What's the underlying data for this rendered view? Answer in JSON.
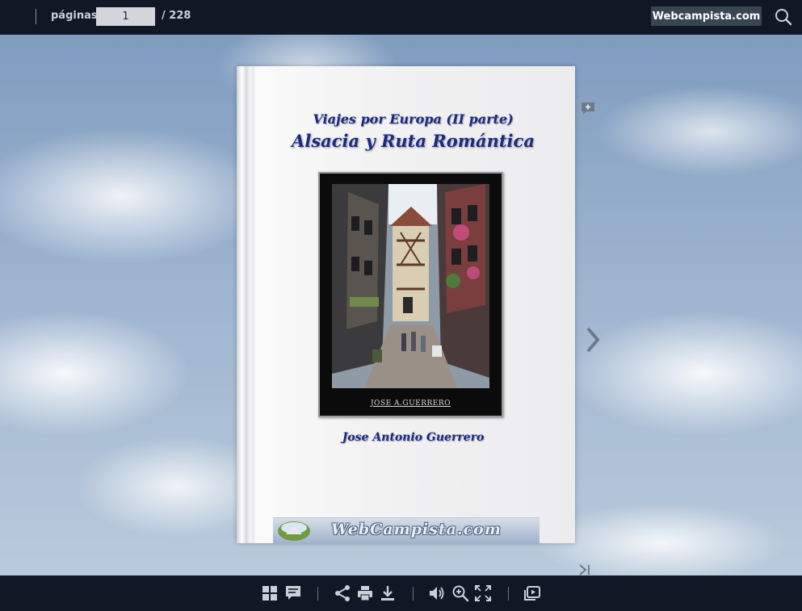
{
  "topbar": {
    "pages_label": "páginas:",
    "current_page": "1",
    "total_pages": "/ 228",
    "site_button_label": "Webcampista.com"
  },
  "book": {
    "kicker": "Viajes por Europa (II parte)",
    "title": "Alsacia y Ruta Romántica",
    "photo_caption": "JOSE A.GUERRERO",
    "author": "Jose Antonio Guerrero",
    "banner_text": "WebCampista.com"
  },
  "colors": {
    "bar_bg": "#0f1824",
    "title_blue": "#1a2a86",
    "site_button_bg": "#3a4552"
  },
  "icons": {
    "topbar": [
      "search-icon"
    ],
    "side": [
      "add-note-icon",
      "chevron-right-icon",
      "last-page-icon"
    ],
    "bottombar": [
      "thumbnails-icon",
      "notes-icon",
      "share-icon",
      "print-icon",
      "download-icon",
      "sound-icon",
      "zoom-in-icon",
      "fullscreen-icon",
      "slideshow-icon"
    ]
  }
}
